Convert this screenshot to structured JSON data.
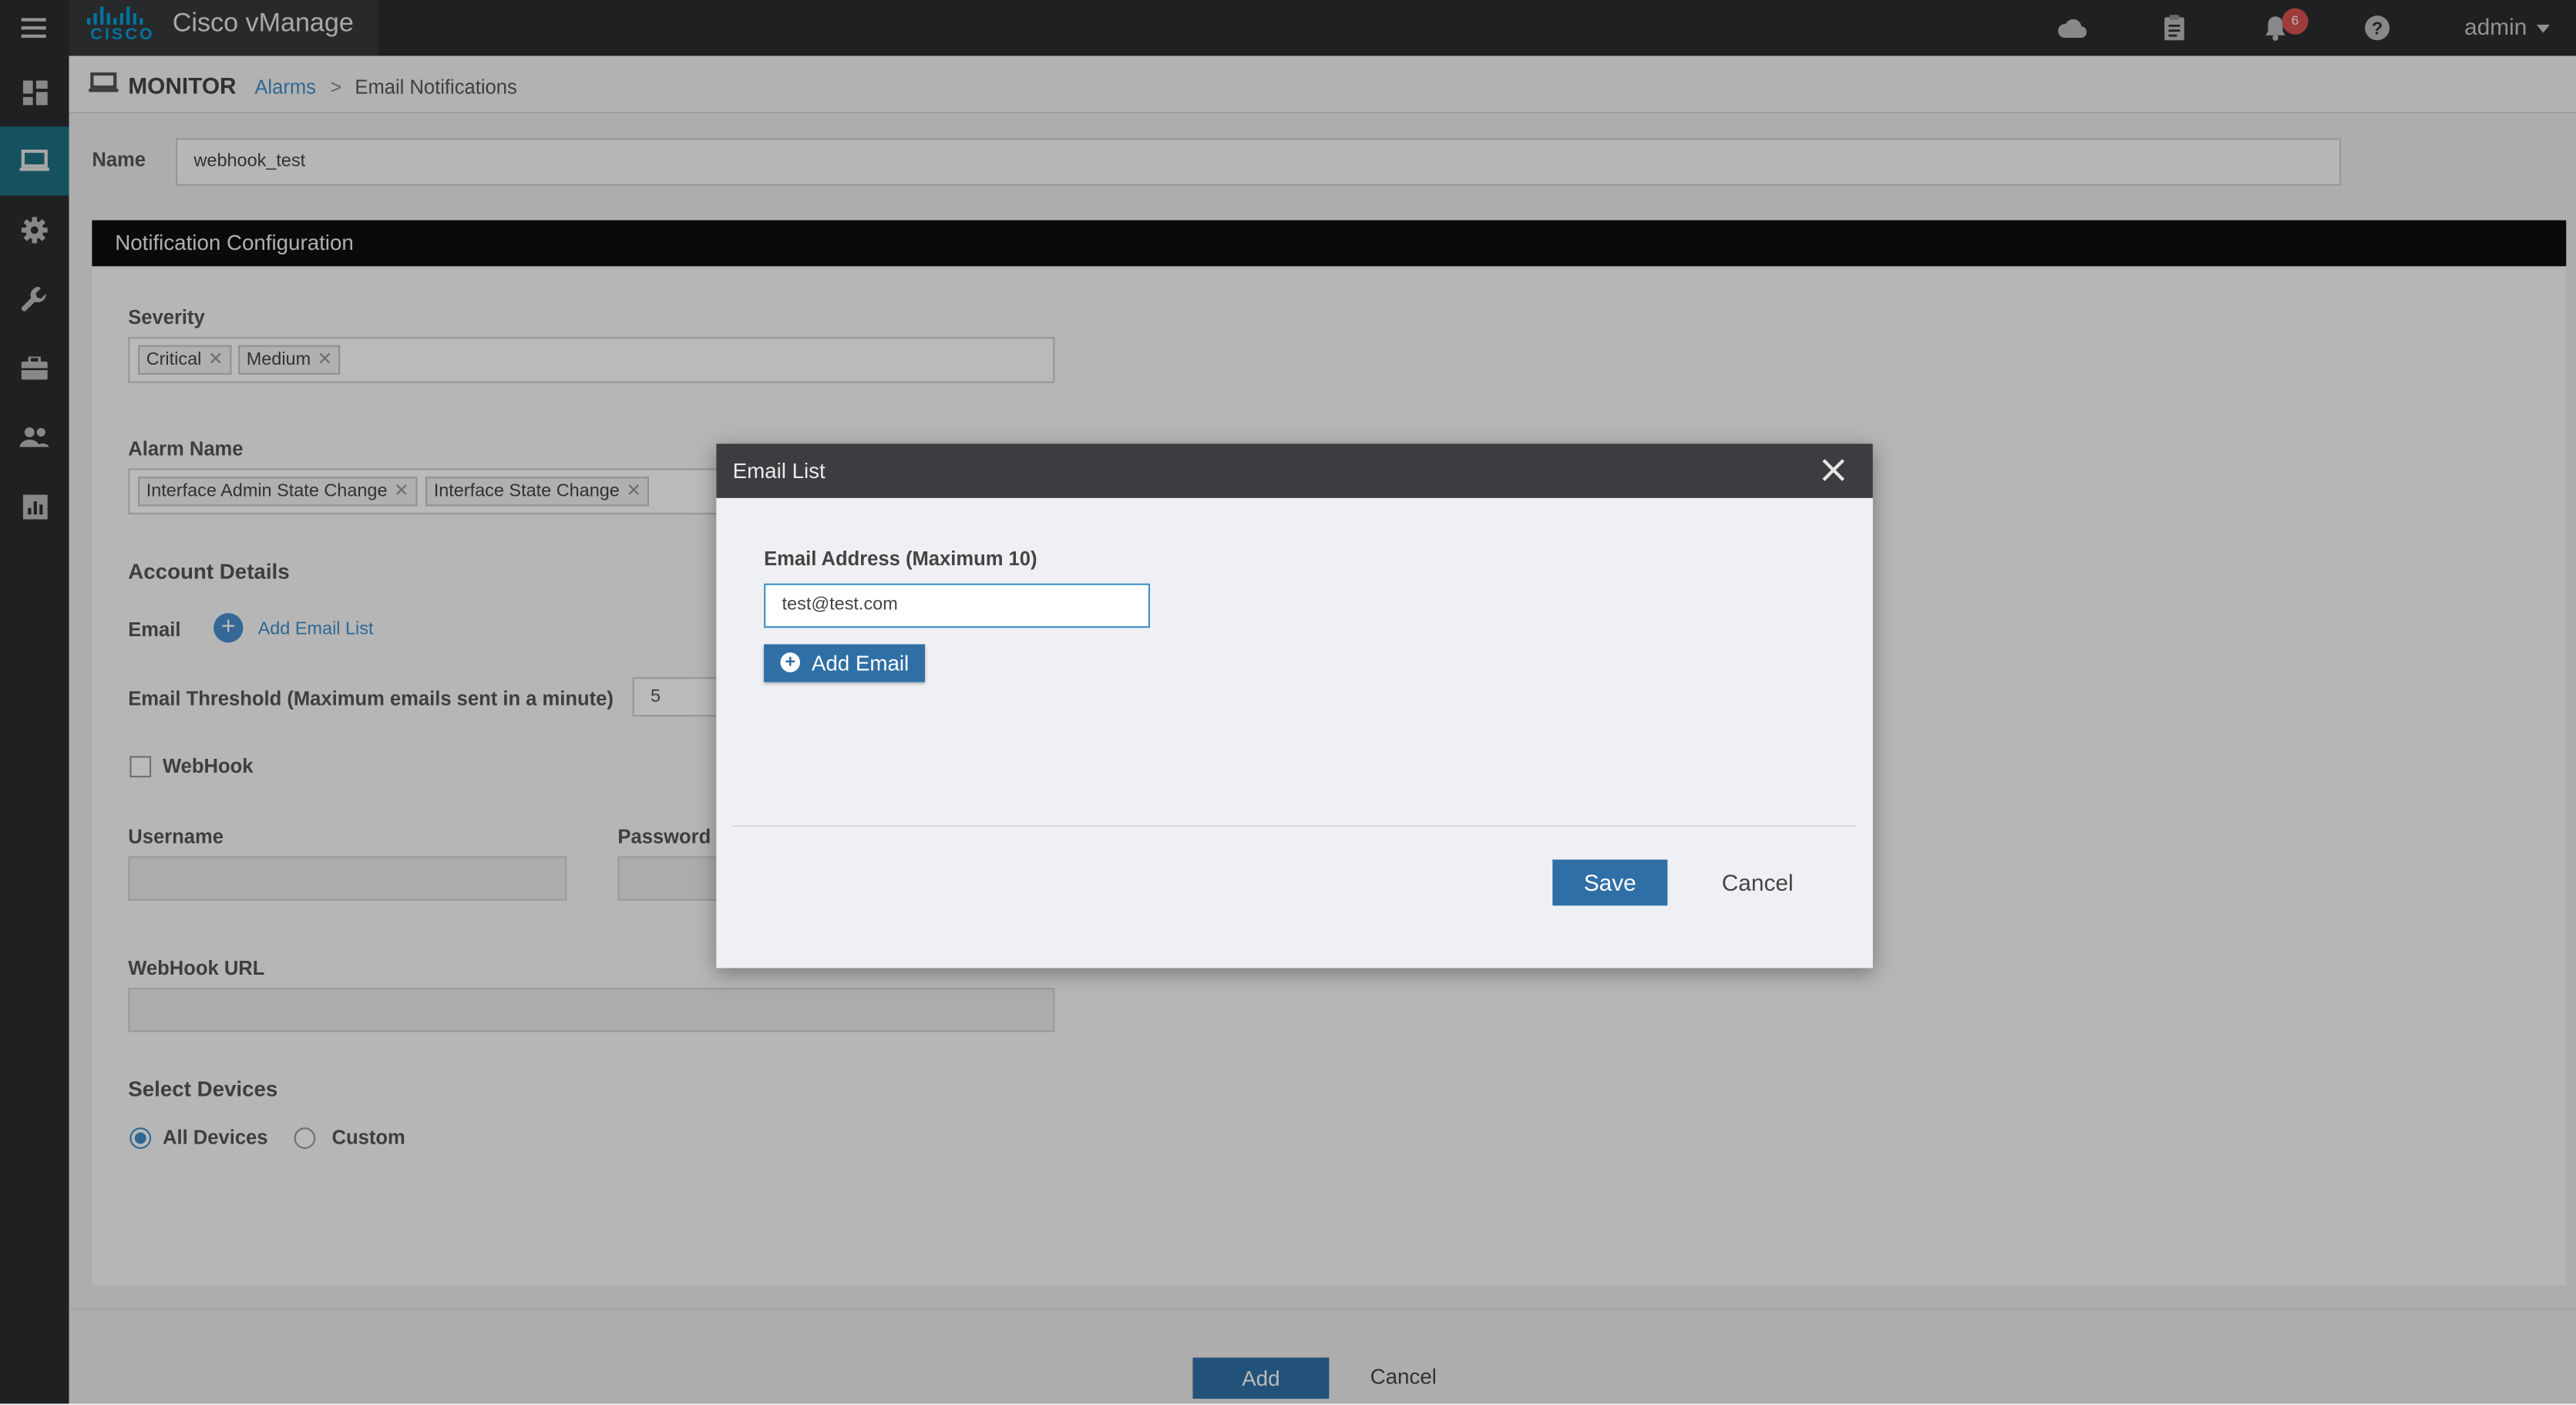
{
  "app": {
    "title": "Cisco vManage",
    "logo_text": "CISCO"
  },
  "topbar": {
    "notification_count": "6",
    "user": "admin"
  },
  "header": {
    "section": "MONITOR",
    "breadcrumb_link": "Alarms",
    "breadcrumb_sep": ">",
    "breadcrumb_current": "Email Notifications"
  },
  "form": {
    "name_label": "Name",
    "name_value": "webhook_test",
    "panel_title": "Notification Configuration",
    "severity_label": "Severity",
    "severity_tags": [
      "Critical",
      "Medium"
    ],
    "alarm_name_label": "Alarm Name",
    "alarm_tags": [
      "Interface Admin State Change",
      "Interface State Change"
    ],
    "account_details_label": "Account Details",
    "email_label": "Email",
    "add_email_list": "Add Email List",
    "threshold_label": "Email Threshold (Maximum emails sent in a minute)",
    "threshold_value": "5",
    "webhook_label": "WebHook",
    "username_label": "Username",
    "password_label": "Password",
    "webhook_url_label": "WebHook URL",
    "select_devices_label": "Select Devices",
    "radio_all": "All Devices",
    "radio_custom": "Custom"
  },
  "footer": {
    "add": "Add",
    "cancel": "Cancel"
  },
  "modal": {
    "title": "Email List",
    "field_label": "Email Address (Maximum 10)",
    "email_value": "test@test.com",
    "add_email": "Add Email",
    "save": "Save",
    "cancel": "Cancel"
  },
  "colors": {
    "accent": "#2f6fa6",
    "link": "#3f8fc8",
    "sidebar_active": "#1f6f82",
    "badge": "#d9534f"
  },
  "icons": [
    "hamburger-icon",
    "cloud-icon",
    "clipboard-icon",
    "bell-icon",
    "help-icon",
    "dashboard-icon",
    "monitor-icon",
    "settings-icon",
    "wrench-icon",
    "briefcase-icon",
    "users-icon",
    "analytics-icon",
    "close-icon",
    "plus-circle-icon"
  ]
}
